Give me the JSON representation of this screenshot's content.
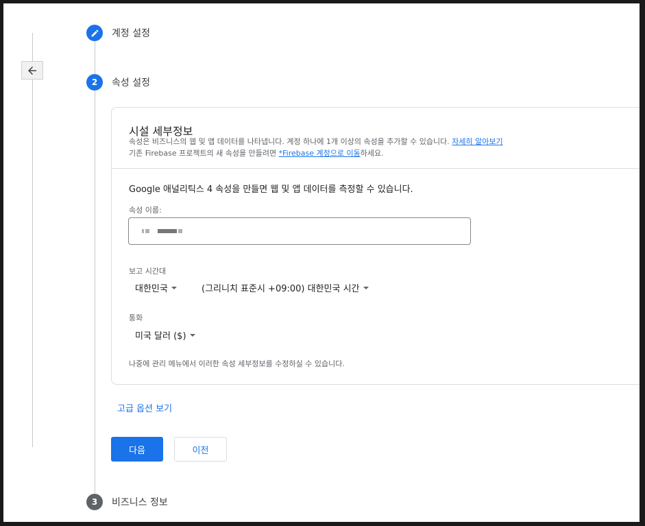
{
  "steps": [
    {
      "number": "",
      "title": "계정 설정",
      "status": "completed",
      "icon": "pencil-icon"
    },
    {
      "number": "2",
      "title": "속성 설정",
      "status": "active"
    },
    {
      "number": "3",
      "title": "비즈니스 정보",
      "status": "pending"
    }
  ],
  "back_icon": "arrow-left-icon",
  "card": {
    "heading": "시설 세부정보",
    "desc_line1": "속성은 비즈니스의 웹 및 앱 데이터를 나타냅니다. 계정 하나에 1개 이상의 속성을 추가할 수 있습니다.",
    "desc_link1": "자세히 알아보기",
    "desc_line2": "기존 Firebase 프로젝트의 새 속성을 만들려면",
    "desc_link2": "*Firebase 계정으로 이동",
    "desc_line2_suffix": "하세요.",
    "main_text": "Google 애널리틱스 4 속성을 만들면 웹 및 앱 데이터를 측정할 수 있습니다.",
    "property_name_label": "속성 이름:",
    "timezone_label": "보고 시간대",
    "country_value": "대한민국",
    "timezone_value": "(그리니치 표준시 +09:00) 대한민국 시간",
    "currency_label": "통화",
    "currency_value": "미국 달러 ($)",
    "footer_note": "나중에 관리 메뉴에서 이러한 속성 세부정보를 수정하실 수 있습니다."
  },
  "advanced_link": "고급 옵션 보기",
  "buttons": {
    "next": "다음",
    "prev": "이전"
  },
  "colors": {
    "accent": "#1a73e8",
    "step_pending": "#5f6368"
  }
}
